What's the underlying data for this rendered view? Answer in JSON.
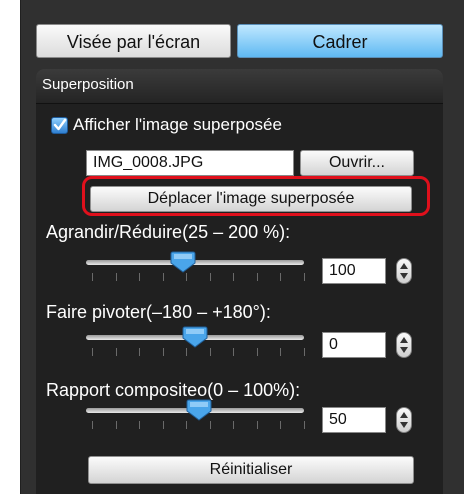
{
  "tabs": {
    "left_label": "Visée par l'écran",
    "right_label": "Cadrer"
  },
  "section": {
    "title": "Superposition",
    "show_overlay_label": "Afficher l'image superposée",
    "file_name": "IMG_0008.JPG",
    "open_button": "Ouvrir...",
    "move_button": "Déplacer l'image superposée"
  },
  "sliders": [
    {
      "label": "Agrandir/Réduire(25 – 200 %):",
      "value": "100",
      "level_percent": 42
    },
    {
      "label": "Faire pivoter(–180 – +180°):",
      "value": "0",
      "level_percent": 50
    },
    {
      "label": "Rapport compositeo(0 – 100%):",
      "value": "50",
      "level_percent": 50
    }
  ],
  "reset_button": "Réinitialiser",
  "colors": {
    "panel_bg": "#303030",
    "highlight": "#e0101c",
    "tab_active": "#5fb9f2"
  },
  "icons": [
    "checkmark-icon",
    "slider-knob-icon",
    "stepper-arrows-icon"
  ]
}
